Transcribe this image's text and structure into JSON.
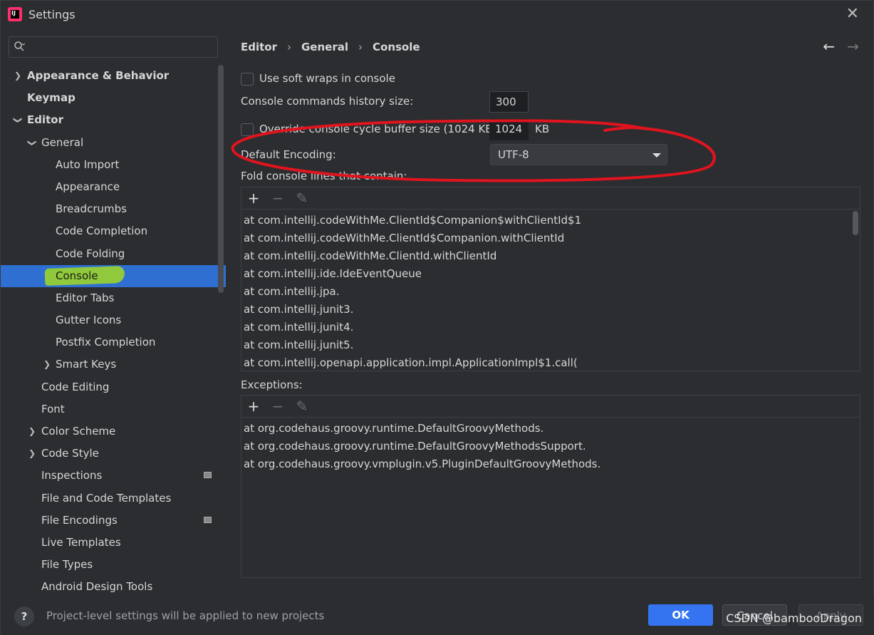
{
  "window": {
    "title": "Settings"
  },
  "search": {
    "placeholder": ""
  },
  "breadcrumb": [
    "Editor",
    "General",
    "Console"
  ],
  "sidebar": {
    "items": [
      {
        "label": "Appearance & Behavior"
      },
      {
        "label": "Keymap"
      },
      {
        "label": "Editor"
      },
      {
        "label": "General"
      },
      {
        "label": "Auto Import"
      },
      {
        "label": "Appearance"
      },
      {
        "label": "Breadcrumbs"
      },
      {
        "label": "Code Completion"
      },
      {
        "label": "Code Folding"
      },
      {
        "label": "Console"
      },
      {
        "label": "Editor Tabs"
      },
      {
        "label": "Gutter Icons"
      },
      {
        "label": "Postfix Completion"
      },
      {
        "label": "Smart Keys"
      },
      {
        "label": "Code Editing"
      },
      {
        "label": "Font"
      },
      {
        "label": "Color Scheme"
      },
      {
        "label": "Code Style"
      },
      {
        "label": "Inspections"
      },
      {
        "label": "File and Code Templates"
      },
      {
        "label": "File Encodings"
      },
      {
        "label": "Live Templates"
      },
      {
        "label": "File Types"
      },
      {
        "label": "Android Design Tools"
      }
    ]
  },
  "console": {
    "soft_wraps_label": "Use soft wraps in console",
    "history_label": "Console commands history size:",
    "history_value": "300",
    "override_label": "Override console cycle buffer size (1024 KB)",
    "override_value": "1024",
    "override_unit": "KB",
    "encoding_label": "Default Encoding:",
    "encoding_value": "UTF-8",
    "fold_label": "Fold console lines that contain:",
    "fold_lines": [
      "at com.intellij.codeWithMe.ClientId$Companion$withClientId$1",
      "at com.intellij.codeWithMe.ClientId$Companion.withClientId",
      "at com.intellij.codeWithMe.ClientId.withClientId",
      "at com.intellij.ide.IdeEventQueue",
      "at com.intellij.jpa.",
      "at com.intellij.junit3.",
      "at com.intellij.junit4.",
      "at com.intellij.junit5.",
      "at com.intellij.openapi.application.impl.ApplicationImpl$1.call("
    ],
    "exceptions_label": "Exceptions:",
    "exceptions": [
      "at org.codehaus.groovy.runtime.DefaultGroovyMethods.",
      "at org.codehaus.groovy.runtime.DefaultGroovyMethodsSupport.",
      "at org.codehaus.groovy.vmplugin.v5.PluginDefaultGroovyMethods."
    ]
  },
  "footer": {
    "help": "?",
    "note": "Project-level settings will be applied to new projects",
    "ok": "OK",
    "cancel": "Cancel",
    "apply": "Apply"
  },
  "watermark": "CSDN @bambooDragon",
  "colors": {
    "accent": "#3574f0",
    "selection": "#2e6fd1",
    "highlight": "#9bd32a",
    "annotation": "#e0141e"
  }
}
